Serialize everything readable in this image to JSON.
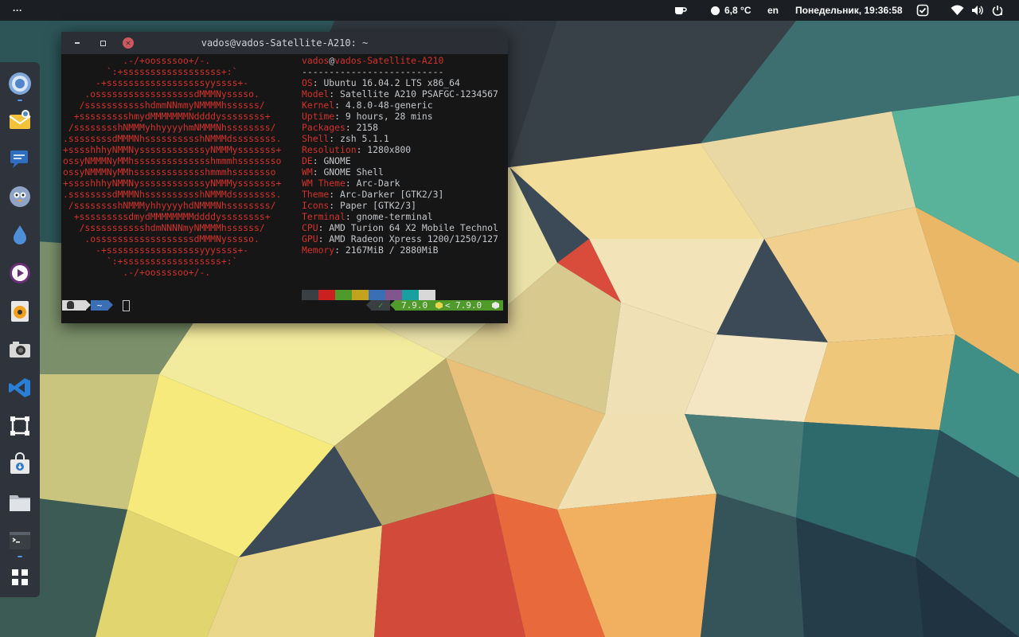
{
  "topbar": {
    "activities_glyph": "···",
    "weather": "6,8 °C",
    "keyboard_layout": "en",
    "datetime": "Понедельник, 19:36:58"
  },
  "dock": {
    "items": [
      {
        "name": "chromium-icon"
      },
      {
        "name": "mail-icon"
      },
      {
        "name": "chat-icon"
      },
      {
        "name": "pidgin-icon"
      },
      {
        "name": "water-drop-icon"
      },
      {
        "name": "media-player-icon"
      },
      {
        "name": "speaker-icon"
      },
      {
        "name": "camera-icon"
      },
      {
        "name": "vscode-icon"
      },
      {
        "name": "inkscape-icon"
      },
      {
        "name": "software-center-icon"
      },
      {
        "name": "files-icon"
      },
      {
        "name": "terminal-icon"
      },
      {
        "name": "app-grid-icon"
      }
    ]
  },
  "terminal": {
    "title": "vados@vados-Satellite-A210: ~",
    "logo_lines": [
      "           .-/+oossssoo+/-.",
      "        `:+ssssssssssssssssss+:`",
      "      -+ssssssssssssssssssyyssss+-",
      "    .ossssssssssssssssssdMMMNysssso.",
      "   /ssssssssssshdmmNNmmyNMMMMhssssss/",
      "  +ssssssssshmydMMMMMMMNddddyssssssss+",
      " /sssssssshNMMMyhhyyyyhmNMMMNhssssssss/",
      ".ssssssssdMMMNhsssssssssshNMMMdssssssss.",
      "+sssshhhyNMMNyssssssssssssyNMMMysssssss+",
      "ossyNMMMNyMMhsssssssssssssshmmmhssssssso",
      "ossyNMMMNyMMhssssssssssssshmmmhssssssso",
      "+sssshhhyNMMNyssssssssssssyNMMMysssssss+",
      ".ssssssssdMMMNhsssssssssshNMMMdssssssss.",
      " /sssssssshNMMMyhhyyyyhdNMMMNhssssssss/",
      "  +sssssssssdmydMMMMMMMMddddyssssssss+",
      "   /ssssssssssshdmNNNNmyNMMMMhssssss/",
      "    .ossssssssssssssssssdMMMNysssso.",
      "      -+sssssssssssssssssyyyssss+-",
      "        `:+ssssssssssssssssss+:`",
      "           .-/+oossssoo+/-."
    ],
    "header_user": "vados",
    "header_at": "@",
    "header_host": "vados-Satellite-A210",
    "separator": "--------------------------",
    "info": [
      {
        "key": "OS",
        "value": "Ubuntu 16.04.2 LTS x86_64"
      },
      {
        "key": "Model",
        "value": "Satellite A210 PSAFGC-1234567"
      },
      {
        "key": "Kernel",
        "value": "4.8.0-48-generic"
      },
      {
        "key": "Uptime",
        "value": "9 hours, 28 mins"
      },
      {
        "key": "Packages",
        "value": "2158"
      },
      {
        "key": "Shell",
        "value": "zsh 5.1.1"
      },
      {
        "key": "Resolution",
        "value": "1280x800"
      },
      {
        "key": "DE",
        "value": "GNOME"
      },
      {
        "key": "WM",
        "value": "GNOME Shell"
      },
      {
        "key": "WM Theme",
        "value": "Arc-Dark"
      },
      {
        "key": "Theme",
        "value": "Arc-Darker [GTK2/3]"
      },
      {
        "key": "Icons",
        "value": "Paper [GTK2/3]"
      },
      {
        "key": "Terminal",
        "value": "gnome-terminal"
      },
      {
        "key": "CPU",
        "value": "AMD Turion 64 X2 Mobile Technol"
      },
      {
        "key": "GPU",
        "value": "AMD Radeon Xpress 1200/1250/127"
      },
      {
        "key": "Memory",
        "value": "2167MiB / 2880MiB"
      }
    ],
    "colors": [
      "#3a3f44",
      "#cc1f1f",
      "#4f9a2b",
      "#c3a31c",
      "#3b6fb5",
      "#82558f",
      "#18a0a0",
      "#d8d8d8"
    ],
    "prompt": {
      "home": "~",
      "cursor": " ",
      "status": "✓",
      "node_version": "7.9.0",
      "npm_version": "7.9.0"
    }
  }
}
